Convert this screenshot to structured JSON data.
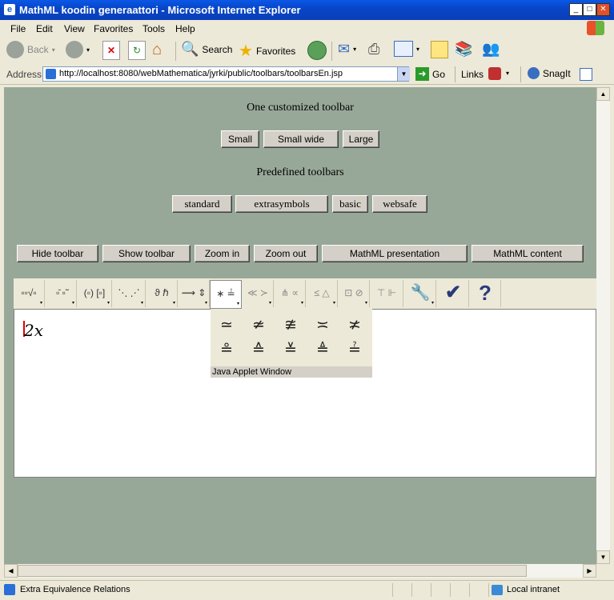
{
  "window": {
    "title": "MathML koodin generaattori - Microsoft Internet Explorer",
    "min": "_",
    "max": "□",
    "close": "✕"
  },
  "menu": [
    "File",
    "Edit",
    "View",
    "Favorites",
    "Tools",
    "Help"
  ],
  "toolbar": {
    "back": "Back",
    "search": "Search",
    "favorites": "Favorites"
  },
  "address": {
    "label": "Address",
    "url": "http://localhost:8080/webMathematica/jyrki/public/toolbars/toolbarsEn.jsp",
    "go": "Go",
    "links": "Links",
    "snagit": "SnagIt"
  },
  "page": {
    "heading1": "One customized toolbar",
    "sizes": [
      "Small",
      "Small wide",
      "Large"
    ],
    "heading2": "Predefined toolbars",
    "predefined": [
      "standard",
      "extrasymbols",
      "basic",
      "websafe"
    ],
    "actions": [
      "Hide toolbar",
      "Show toolbar",
      "Zoom in",
      "Zoom out",
      "MathML presentation",
      "MathML content"
    ]
  },
  "math_toolbar": {
    "palettes": [
      "▫▫√▫",
      "▫̄ ▫̃",
      "(▫) [▫]",
      "⋱ ⋰",
      "ϑ ℏ",
      "⟿ ⇕",
      "∗ ≟",
      "≪ ≻",
      "⋔ ∝",
      "≤ △",
      "⊡ ⊘",
      "⊤ ⊩"
    ],
    "tools": [
      "wrench-icon",
      "check-icon",
      "help-icon"
    ],
    "help_glyph": "?",
    "check_glyph": "✔",
    "wrench_glyph": "🔧"
  },
  "editor": {
    "expression": "2x"
  },
  "popup": {
    "symbols_row1": [
      "≃",
      "≄",
      "≇",
      "≍",
      "≭"
    ],
    "symbols_row2": [
      "≗",
      "≙",
      "≚",
      "≜",
      "≟"
    ],
    "label": "Java Applet Window"
  },
  "status": {
    "text": "Extra Equivalence Relations",
    "zone": "Local intranet"
  }
}
